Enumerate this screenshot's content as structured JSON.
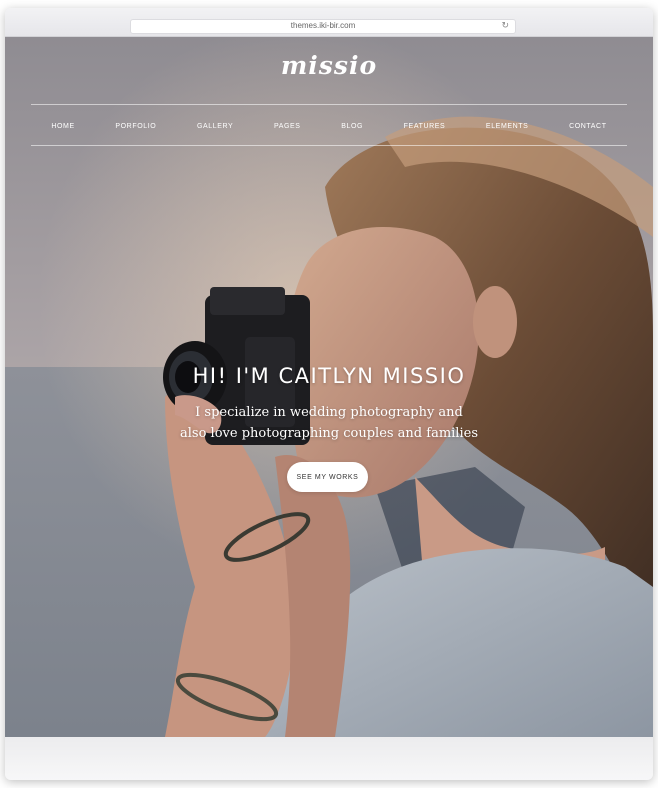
{
  "browser": {
    "url": "themes.iki-bir.com",
    "reload_icon": "↻"
  },
  "site": {
    "logo": "missio"
  },
  "nav": {
    "items": [
      {
        "label": "HOME"
      },
      {
        "label": "PORFOLIO"
      },
      {
        "label": "GALLERY"
      },
      {
        "label": "PAGES"
      },
      {
        "label": "BLOG"
      },
      {
        "label": "FEATURES"
      },
      {
        "label": "ELEMENTS"
      },
      {
        "label": "CONTACT"
      }
    ]
  },
  "hero": {
    "headline": "HI! I'M CAITLYN MISSIO",
    "subline_1": "I specialize in wedding photography and",
    "subline_2": "also love photographing couples and families",
    "button_label": "SEE MY WORKS",
    "image_subject": "woman-with-camera-photo"
  },
  "colors": {
    "text": "#ffffff",
    "button_bg": "#ffffff",
    "button_text": "#333333"
  }
}
